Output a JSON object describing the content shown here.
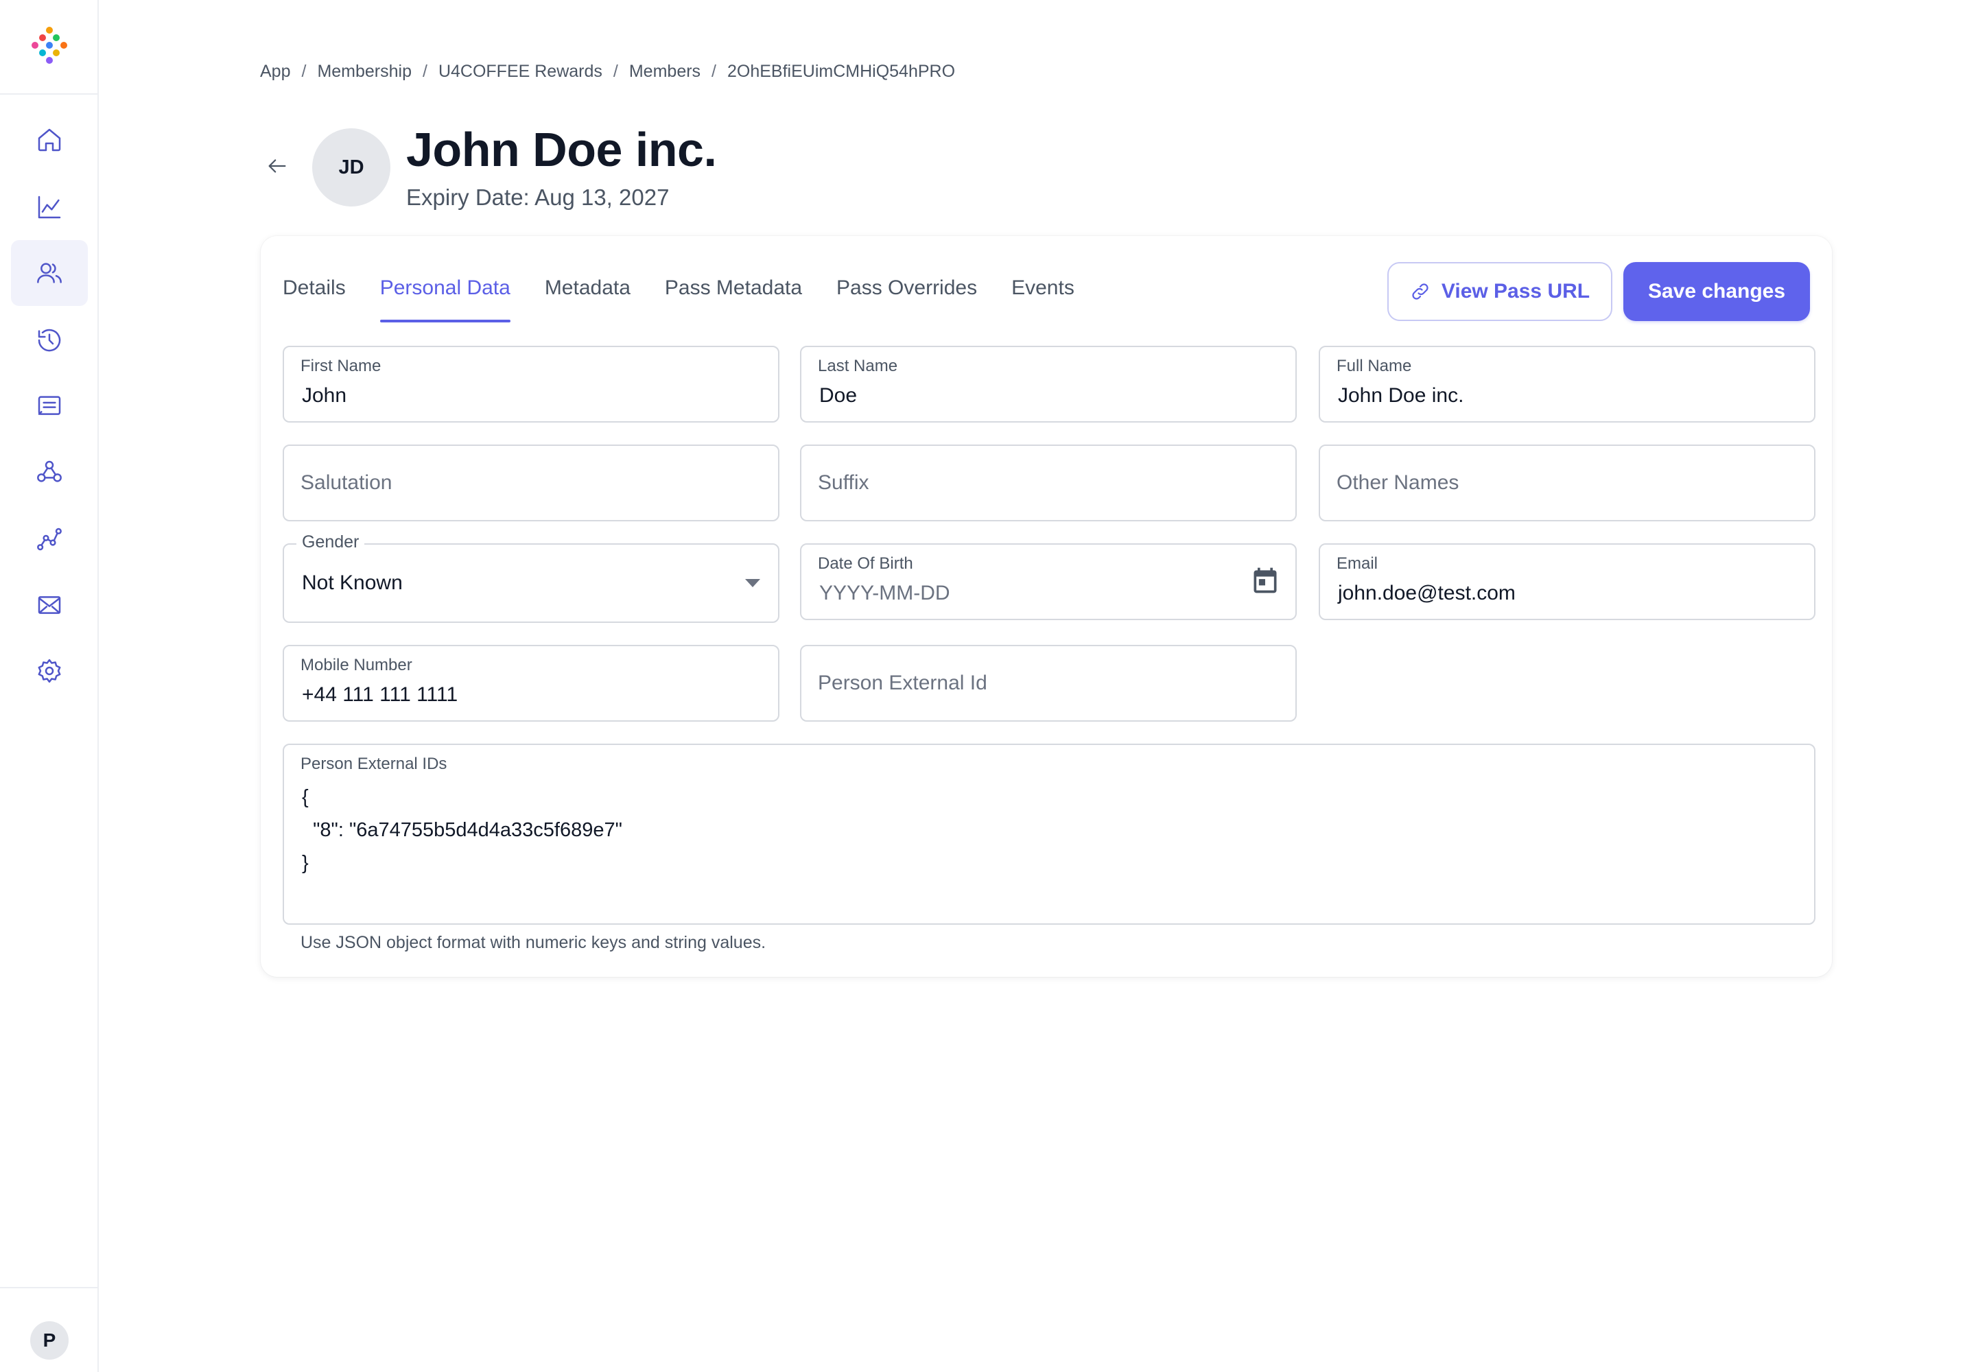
{
  "breadcrumb": [
    "App",
    "Membership",
    "U4COFFEE Rewards",
    "Members",
    "2OhEBfiEUimCMHiQ54hPRO"
  ],
  "header": {
    "avatar_initials": "JD",
    "title": "John Doe inc.",
    "expiry": "Expiry Date: Aug 13, 2027"
  },
  "sidebar": {
    "items": [
      {
        "icon": "home-icon"
      },
      {
        "icon": "chart-icon"
      },
      {
        "icon": "users-icon",
        "active": true
      },
      {
        "icon": "history-icon"
      },
      {
        "icon": "message-icon"
      },
      {
        "icon": "webhook-icon"
      },
      {
        "icon": "analytics-icon"
      },
      {
        "icon": "mail-icon"
      },
      {
        "icon": "settings-icon"
      }
    ],
    "user_initial": "P"
  },
  "tabs": [
    {
      "label": "Details",
      "active": false
    },
    {
      "label": "Personal Data",
      "active": true
    },
    {
      "label": "Metadata",
      "active": false
    },
    {
      "label": "Pass Metadata",
      "active": false
    },
    {
      "label": "Pass Overrides",
      "active": false
    },
    {
      "label": "Events",
      "active": false
    }
  ],
  "actions": {
    "view_pass_url": "View Pass URL",
    "save_changes": "Save changes"
  },
  "form": {
    "first_name": {
      "label": "First Name",
      "value": "John"
    },
    "last_name": {
      "label": "Last Name",
      "value": "Doe"
    },
    "full_name": {
      "label": "Full Name",
      "value": "John Doe inc."
    },
    "salutation": {
      "placeholder": "Salutation"
    },
    "suffix": {
      "placeholder": "Suffix"
    },
    "other_names": {
      "placeholder": "Other Names"
    },
    "gender": {
      "label": "Gender",
      "value": "Not Known"
    },
    "date_of_birth": {
      "label": "Date Of Birth",
      "placeholder": "YYYY-MM-DD"
    },
    "email": {
      "label": "Email",
      "value": "john.doe@test.com"
    },
    "mobile_number": {
      "label": "Mobile Number",
      "value": "+44 111 111 1111"
    },
    "person_external_id": {
      "placeholder": "Person External Id"
    },
    "person_external_ids": {
      "label": "Person External IDs",
      "value": "{\n  \"8\": \"6a74755b5d4d4a33c5f689e7\"\n}",
      "helper": "Use JSON object format with numeric keys and string values."
    }
  },
  "colors": {
    "accent": "#5b5fe6",
    "primary_button": "#5f63ec",
    "border": "#d6d9df"
  }
}
